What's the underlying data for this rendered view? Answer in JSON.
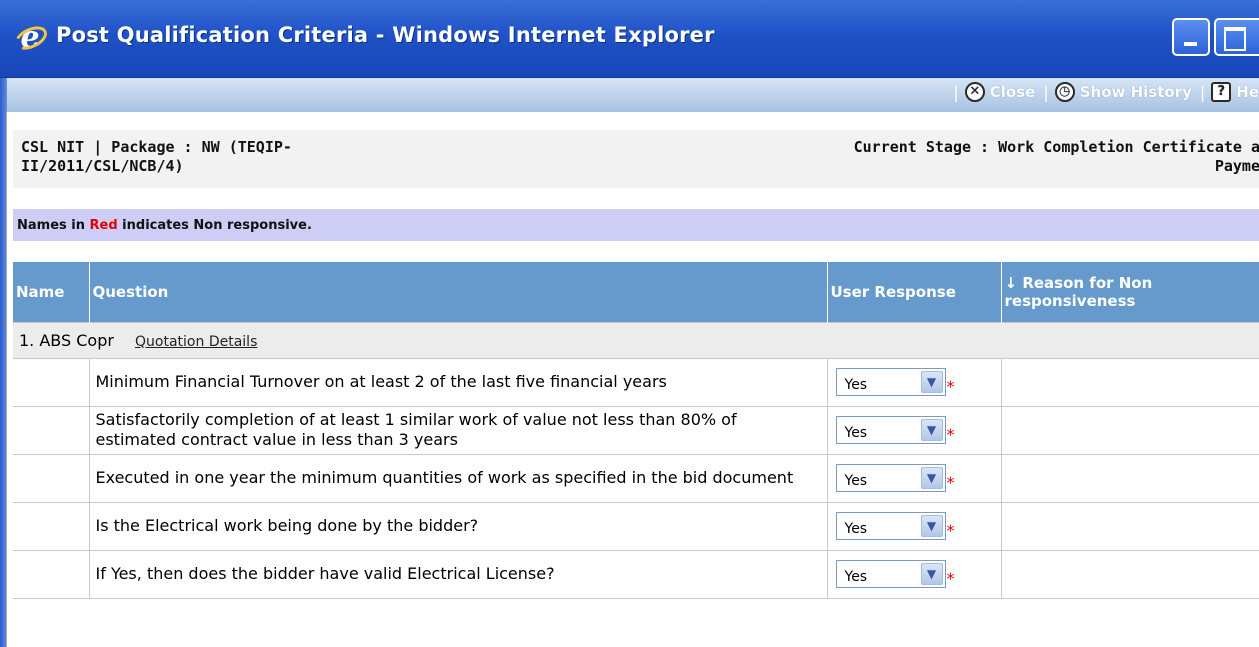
{
  "window": {
    "title": "Post Qualification Criteria - Windows Internet Explorer"
  },
  "toolbar": {
    "items": [
      {
        "label": "Close",
        "icon": "close-circle-icon"
      },
      {
        "label": "Show History",
        "icon": "clock-history-icon"
      },
      {
        "label": "He",
        "icon": "help-icon"
      }
    ]
  },
  "header": {
    "left_text": "CSL NIT | Package : NW (TEQIP-II/2011/CSL/NCB/4)",
    "right_line1": "Current Stage : Work Completion Certificate a",
    "right_line2": "Payme"
  },
  "note": {
    "prefix": "Names in ",
    "red_word": "Red",
    "suffix": " indicates Non responsive."
  },
  "table": {
    "columns": [
      "Name",
      "Question",
      "User Response",
      "Reason for Non responsiveness"
    ],
    "sort_indicator": "↓",
    "group": {
      "name": "1. ABS Copr",
      "link": "Quotation Details"
    },
    "rows": [
      {
        "question": "Minimum Financial Turnover on at least 2 of the last five financial years",
        "response": "Yes"
      },
      {
        "question": "Satisfactorily completion of at least 1 similar work of value not less than 80% of estimated contract value in less than 3 years",
        "response": "Yes"
      },
      {
        "question": "Executed in one year the minimum quantities of work as specified in the bid document",
        "response": "Yes"
      },
      {
        "question": "Is the Electrical work being done by the bidder?",
        "response": "Yes"
      },
      {
        "question": "If Yes, then does the bidder have valid Electrical License?",
        "response": "Yes"
      }
    ],
    "required_marker": "*"
  },
  "colors": {
    "titlebar": "#1f52c7",
    "table_header": "#6699cc",
    "note_band": "#cdcdf5",
    "non_responsive": "#e00000"
  }
}
